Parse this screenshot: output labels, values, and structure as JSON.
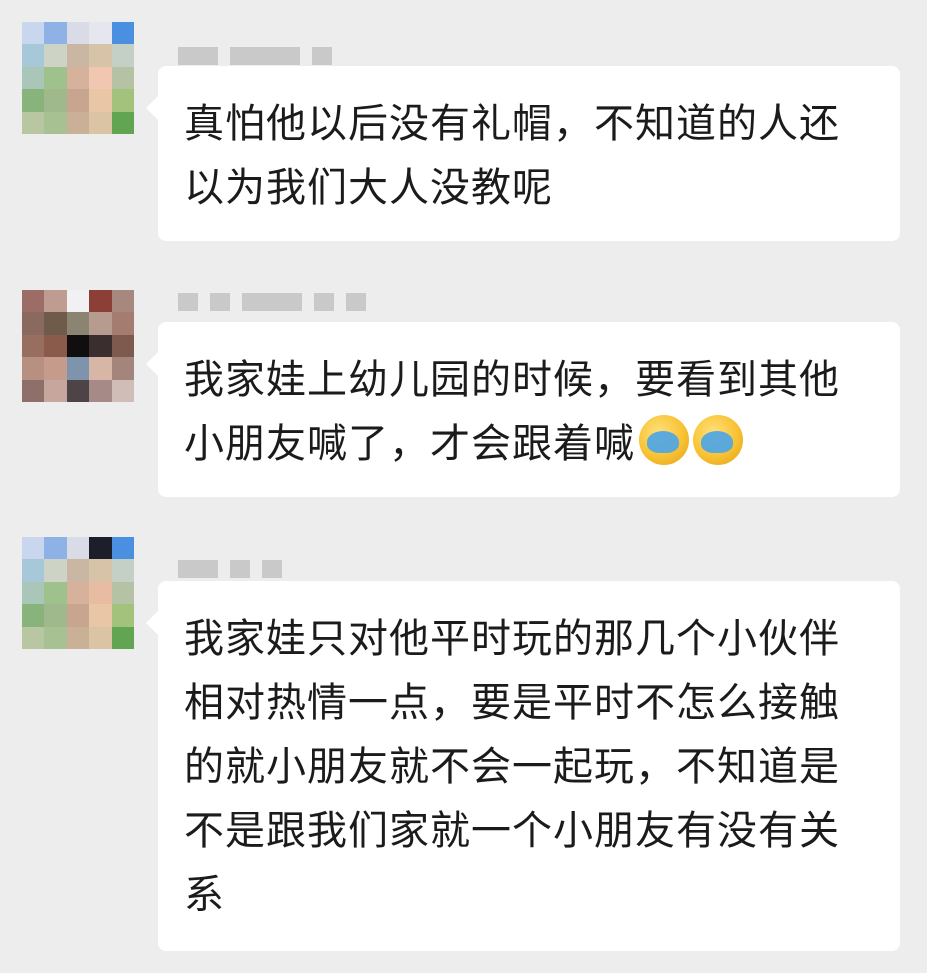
{
  "messages": [
    {
      "text": "真怕他以后没有礼帽，不知道的人还以为我们大人没教呢",
      "avatar_colors": [
        "#c9d7ee",
        "#8fb2e6",
        "#d9dbe7",
        "#e6e6ee",
        "#4a8fe0",
        "#a6c8d8",
        "#cdd4c5",
        "#c9b7a4",
        "#d7c3a7",
        "#c4d0c6",
        "#a9c6b8",
        "#9fc18b",
        "#d6b29d",
        "#f1c7b1",
        "#b6c2a4",
        "#88b37a",
        "#9fb98d",
        "#c7a58e",
        "#e9c6a5",
        "#a3c27c",
        "#b8c6a1",
        "#a8c193",
        "#c9b096",
        "#dbc4a3",
        "#61a552"
      ]
    },
    {
      "text": "我家娃上幼儿园的时候，要看到其他小朋友喊了，才会跟着喊",
      "emojis": [
        "facepalm-laugh-emoji",
        "facepalm-laugh-emoji"
      ],
      "avatar_colors": [
        "#9c6d66",
        "#bf9c91",
        "#f1f1f4",
        "#8b3f36",
        "#a7887e",
        "#8a6a5f",
        "#6f5b49",
        "#8c8472",
        "#b69c8f",
        "#a57d70",
        "#986e61",
        "#8a5a4a",
        "#110e10",
        "#3b2e2e",
        "#7d5a4d",
        "#b89081",
        "#c59b8c",
        "#7e94ad",
        "#d7b6a5",
        "#a4857c",
        "#8f6f6a",
        "#c6a69d",
        "#4e4447",
        "#a58a87",
        "#d1bdb7"
      ]
    },
    {
      "text": "我家娃只对他平时玩的那几个小伙伴相对热情一点，要是平时不怎么接触的就小朋友就不会一起玩，不知道是不是跟我们家就一个小朋友有没有关系",
      "avatar_colors": [
        "#c9d7ee",
        "#8fb2e6",
        "#d9dbe7",
        "#1c1f29",
        "#4a8fe0",
        "#a6c8d8",
        "#cdd4c5",
        "#c9b7a4",
        "#d7c3a7",
        "#c4d0c6",
        "#a9c6b8",
        "#9fc18b",
        "#d6b29d",
        "#e8bca3",
        "#b6c2a4",
        "#88b37a",
        "#9fb98d",
        "#c7a58e",
        "#e9c6a5",
        "#a3c27c",
        "#b8c6a1",
        "#a8c193",
        "#c9b096",
        "#dbc4a3",
        "#61a552"
      ]
    }
  ]
}
